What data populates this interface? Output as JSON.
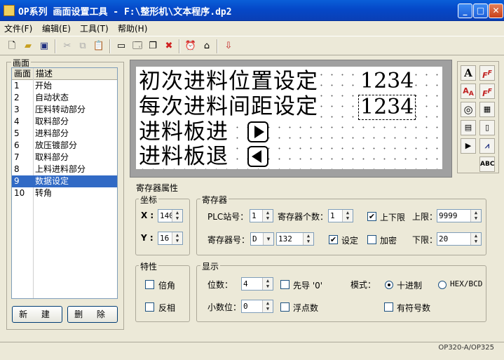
{
  "window": {
    "title": "OP系列 画面设置工具 - F:\\整形机\\文本程序.dp2"
  },
  "menu": [
    {
      "label": "文件(F)"
    },
    {
      "label": "编辑(E)"
    },
    {
      "label": "工具(T)"
    },
    {
      "label": "帮助(H)"
    }
  ],
  "screens": {
    "group_label": "画面",
    "columns": [
      "画面",
      "描述"
    ],
    "rows": [
      {
        "id": "1",
        "desc": "开始"
      },
      {
        "id": "2",
        "desc": "自动状态"
      },
      {
        "id": "3",
        "desc": "压料转动部分"
      },
      {
        "id": "4",
        "desc": "取料部分"
      },
      {
        "id": "5",
        "desc": "进料部分"
      },
      {
        "id": "6",
        "desc": "放压镀部分"
      },
      {
        "id": "7",
        "desc": "取料部分"
      },
      {
        "id": "8",
        "desc": "上料进料部分"
      },
      {
        "id": "9",
        "desc": "数据设定"
      },
      {
        "id": "10",
        "desc": "转角"
      }
    ],
    "selected_index": 8,
    "new_button": "新 建",
    "delete_button": "删 除"
  },
  "canvas": {
    "line1_text": "初次进料位置设定",
    "line1_value": "1234",
    "line2_text": "每次进料间距设定",
    "line2_value": "1234",
    "line3_text": "进料板进",
    "line4_text": "进料板退"
  },
  "toolbox": {
    "abc_label": "ABC"
  },
  "properties": {
    "title": "寄存器属性",
    "coords": {
      "label": "坐标",
      "x_label": "X :",
      "x_value": "140",
      "y_label": "Y :",
      "y_value": "16"
    },
    "register": {
      "label": "寄存器",
      "plc_label": "PLC站号：",
      "plc_value": "1",
      "count_label": "寄存器个数：",
      "count_value": "1",
      "limits_label": "上下限",
      "limits_checked": true,
      "upper_label": "上限：",
      "upper_value": "9999",
      "reg_no_label": "寄存器号：",
      "reg_type": "D",
      "reg_no": "132",
      "set_label": "设定",
      "set_checked": true,
      "encrypt_label": "加密",
      "encrypt_checked": false,
      "lower_label": "下限：",
      "lower_value": "20"
    },
    "features": {
      "label": "特性",
      "double_label": "倍角",
      "double_checked": false,
      "invert_label": "反相",
      "invert_checked": false
    },
    "display": {
      "label": "显示",
      "digits_label": "位数：",
      "digits_value": "4",
      "lead_zero_label": "先导 '0'",
      "lead_zero_checked": false,
      "mode_label": "模式：",
      "decimal_label": "十进制",
      "decimal_selected": true,
      "hex_label": "HEX/BCD",
      "hex_selected": false,
      "decimals_label": "小数位：",
      "decimals_value": "0",
      "float_label": "浮点数",
      "float_checked": false,
      "signed_label": "有符号数",
      "signed_checked": false
    }
  },
  "status": {
    "model": "OP320-A/OP325"
  }
}
